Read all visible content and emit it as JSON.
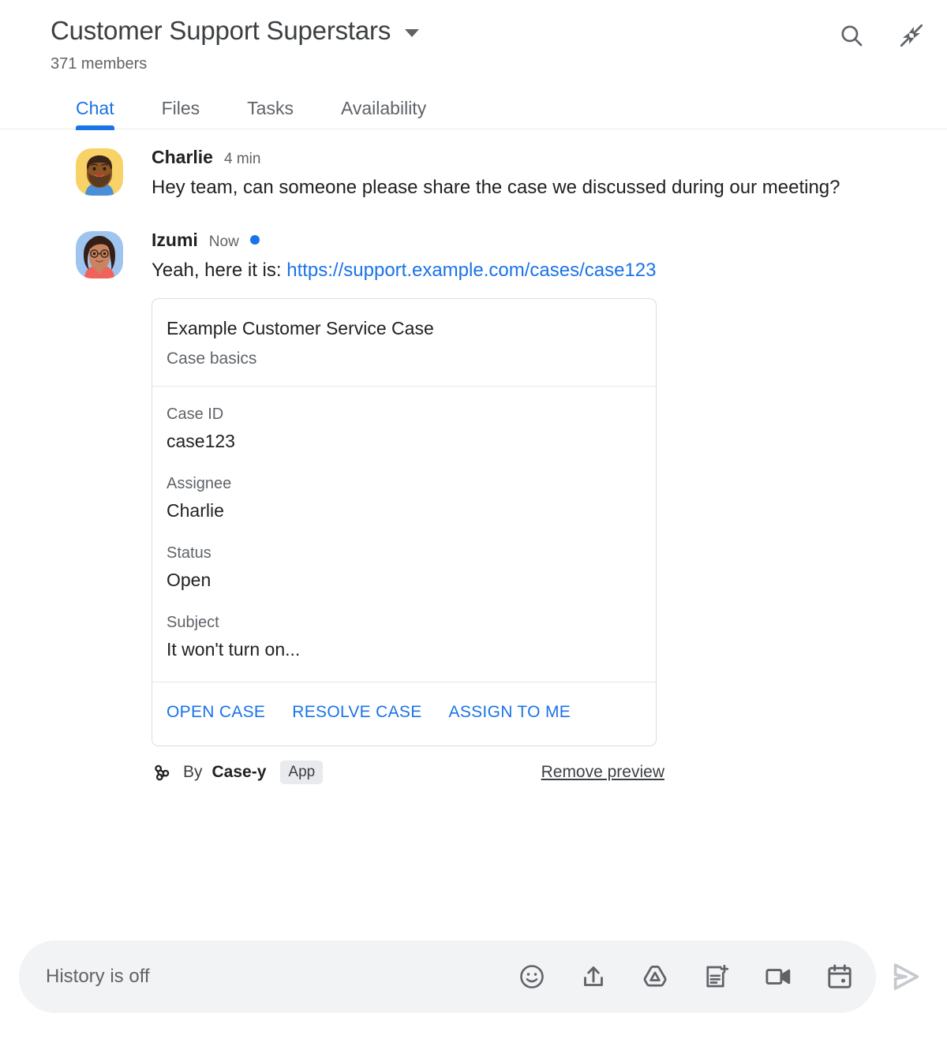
{
  "header": {
    "room_title": "Customer Support Superstars",
    "members": "371 members",
    "dropdown_icon": "chevron-down-icon",
    "actions": [
      {
        "name": "search-icon",
        "label": "Search"
      },
      {
        "name": "collapse-icon",
        "label": "Collapse"
      }
    ]
  },
  "tabs": [
    {
      "label": "Chat",
      "active": true
    },
    {
      "label": "Files",
      "active": false
    },
    {
      "label": "Tasks",
      "active": false
    },
    {
      "label": "Availability",
      "active": false
    }
  ],
  "messages": [
    {
      "author": "Charlie",
      "timestamp": "4 min",
      "unread": false,
      "text": "Hey team, can someone please share the case we discussed during our meeting?"
    },
    {
      "author": "Izumi",
      "timestamp": "Now",
      "unread": true,
      "text_prefix": "Yeah, here it is: ",
      "link_text": "https://support.example.com/cases/case123"
    }
  ],
  "card": {
    "title": "Example Customer Service Case",
    "subtitle": "Case basics",
    "fields": [
      {
        "label": "Case ID",
        "value": "case123"
      },
      {
        "label": "Assignee",
        "value": "Charlie"
      },
      {
        "label": "Status",
        "value": "Open"
      },
      {
        "label": "Subject",
        "value": "It won't turn on..."
      }
    ],
    "actions": [
      {
        "label": "OPEN CASE"
      },
      {
        "label": "RESOLVE CASE"
      },
      {
        "label": "ASSIGN TO ME"
      }
    ]
  },
  "attribution": {
    "icon": "webhook-icon",
    "by_text": "By",
    "app_name": "Case-y",
    "badge": "App",
    "remove_preview": "Remove preview"
  },
  "composer": {
    "placeholder": "History is off",
    "icons": [
      {
        "name": "emoji-icon"
      },
      {
        "name": "upload-icon"
      },
      {
        "name": "google-drive-icon"
      },
      {
        "name": "new-document-icon"
      },
      {
        "name": "video-camera-icon"
      },
      {
        "name": "calendar-icon"
      }
    ],
    "send_icon": "send-icon"
  },
  "colors": {
    "accent": "#1a73e8",
    "text_primary": "#202124",
    "text_secondary": "#5f6368",
    "border": "#dadce0",
    "composer_bg": "#f1f3f4",
    "badge_bg": "#e8eaed"
  }
}
